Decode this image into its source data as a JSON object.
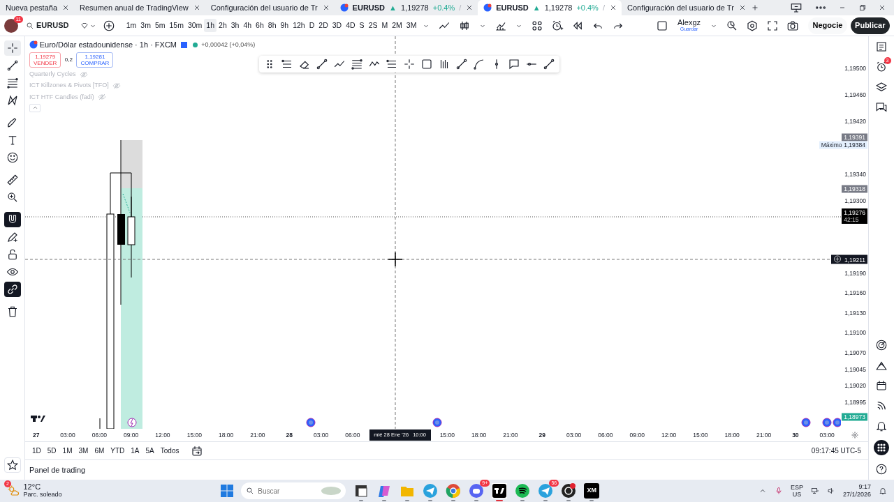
{
  "browser_tabs": [
    {
      "kind": "page",
      "title": "Nueva pestaña",
      "selected": false
    },
    {
      "kind": "page",
      "title": "Resumen anual de TradingView",
      "selected": false
    },
    {
      "kind": "page",
      "title": "Configuración del usuario de Tr",
      "selected": false
    },
    {
      "kind": "symbol",
      "title": "EURUSD",
      "arrow": "▲",
      "price": "1,19278",
      "change": "+0.4%",
      "trail": "/",
      "selected": false
    },
    {
      "kind": "symbol",
      "title": "EURUSD",
      "arrow": "▲",
      "price": "1,19278",
      "change": "+0.4%",
      "trail": "/",
      "selected": true
    },
    {
      "kind": "page",
      "title": "Configuración del usuario de Tr",
      "selected": false
    }
  ],
  "toolbar": {
    "avatar_badge": "11",
    "symbol": "EURUSD",
    "intervals": [
      {
        "label": "1m",
        "selected": false
      },
      {
        "label": "3m",
        "selected": false
      },
      {
        "label": "5m",
        "selected": false
      },
      {
        "label": "15m",
        "selected": false
      },
      {
        "label": "30m",
        "selected": false
      },
      {
        "label": "1h",
        "selected": true
      },
      {
        "label": "2h",
        "selected": false
      },
      {
        "label": "3h",
        "selected": false
      },
      {
        "label": "4h",
        "selected": false
      },
      {
        "label": "6h",
        "selected": false
      },
      {
        "label": "8h",
        "selected": false
      },
      {
        "label": "9h",
        "selected": false
      },
      {
        "label": "12h",
        "selected": false
      },
      {
        "label": "D",
        "selected": false
      },
      {
        "label": "2D",
        "selected": false
      },
      {
        "label": "3D",
        "selected": false
      },
      {
        "label": "4D",
        "selected": false
      },
      {
        "label": "S",
        "selected": false
      },
      {
        "label": "2S",
        "selected": false
      },
      {
        "label": "M",
        "selected": false
      },
      {
        "label": "2M",
        "selected": false
      },
      {
        "label": "3M",
        "selected": false
      }
    ],
    "user": {
      "name": "Alexgz",
      "action": "Guardar"
    },
    "trade_button": "Negocie",
    "publish_button": "Publicar"
  },
  "left_tools": [
    {
      "kind": "crosshair",
      "selected": true,
      "on": false
    },
    {
      "kind": "trendline",
      "selected": false,
      "on": false
    },
    {
      "kind": "fib",
      "selected": false,
      "on": false
    },
    {
      "kind": "pattern",
      "selected": false,
      "on": false
    },
    {
      "kind": "brush",
      "selected": false,
      "on": false
    },
    {
      "kind": "text",
      "selected": false,
      "on": false
    },
    {
      "kind": "smiley",
      "selected": false,
      "on": false
    },
    {
      "kind": "ruler",
      "selected": false,
      "on": false
    },
    {
      "kind": "zoom",
      "selected": false,
      "on": false
    },
    {
      "kind": "magnet",
      "selected": false,
      "on": true
    },
    {
      "kind": "pencil",
      "selected": false,
      "on": false
    },
    {
      "kind": "lock",
      "selected": false,
      "on": false
    },
    {
      "kind": "eye",
      "selected": false,
      "on": false
    },
    {
      "kind": "link",
      "selected": false,
      "on": true
    },
    {
      "kind": "trash",
      "selected": false,
      "on": false
    }
  ],
  "legend": {
    "title": "Euro/Dólar estadounidense · 1h · FXCM",
    "change": "+0,00042 (+0,04%)",
    "sell": {
      "price": "1,19279",
      "label": "VENDER"
    },
    "spread": "0,2",
    "buy": {
      "price": "1,19281",
      "label": "COMPRAR"
    },
    "indicators": [
      {
        "name": "Quarterly Cycles",
        "hidden": true
      },
      {
        "name": "ICT Killzones & Pivots [TFO]",
        "hidden": true
      },
      {
        "name": "ICT HTF Candles (fadi)",
        "hidden": true
      }
    ]
  },
  "price_axis": {
    "ticks": [
      "1,19500",
      "1,19460",
      "1,19420",
      "1,19340",
      "1,19300",
      "1,19190",
      "1,19160",
      "1,19130",
      "1,19100",
      "1,19070",
      "1,19045",
      "1,19020",
      "1,18995"
    ],
    "tags": [
      {
        "kind": "gray",
        "value": "1,19391"
      },
      {
        "kind": "light",
        "value": "1,19384",
        "label": "Máximo"
      },
      {
        "kind": "gray",
        "value": "1,19318"
      },
      {
        "kind": "dark",
        "value": "1,19276",
        "sub": "42:15"
      },
      {
        "kind": "cursor",
        "value": "1,19211"
      },
      {
        "kind": "green",
        "value": "1,18973"
      }
    ]
  },
  "time_axis": [
    {
      "kind": "day",
      "text": "27"
    },
    {
      "kind": "time",
      "text": "03:00"
    },
    {
      "kind": "time",
      "text": "06:00"
    },
    {
      "kind": "time",
      "text": "09:00"
    },
    {
      "kind": "time",
      "text": "12:00"
    },
    {
      "kind": "time",
      "text": "15:00"
    },
    {
      "kind": "time",
      "text": "18:00"
    },
    {
      "kind": "time",
      "text": "21:00"
    },
    {
      "kind": "day",
      "text": "28"
    },
    {
      "kind": "time",
      "text": "03:00"
    },
    {
      "kind": "time",
      "text": "06:00"
    },
    {
      "kind": "cursor",
      "text": "mié 28 Ene '26",
      "time": "10:00"
    },
    {
      "kind": "time",
      "text": "15:00"
    },
    {
      "kind": "time",
      "text": "18:00"
    },
    {
      "kind": "time",
      "text": "21:00"
    },
    {
      "kind": "day",
      "text": "29"
    },
    {
      "kind": "time",
      "text": "03:00"
    },
    {
      "kind": "time",
      "text": "06:00"
    },
    {
      "kind": "time",
      "text": "09:00"
    },
    {
      "kind": "time",
      "text": "12:00"
    },
    {
      "kind": "time",
      "text": "15:00"
    },
    {
      "kind": "time",
      "text": "18:00"
    },
    {
      "kind": "time",
      "text": "21:00"
    },
    {
      "kind": "day",
      "text": "30"
    },
    {
      "kind": "time",
      "text": "03:00"
    }
  ],
  "ranges": [
    "1D",
    "5D",
    "1M",
    "3M",
    "6M",
    "YTD",
    "1A",
    "5A",
    "Todos"
  ],
  "clock": "09:17:45 UTC-5",
  "trading_panel": {
    "title": "Panel de trading"
  },
  "sidebar": {
    "alarm_badge": "3"
  },
  "taskbar": {
    "weather": {
      "badge": "2",
      "temp": "12°C",
      "desc": "Parc. soleado"
    },
    "search": {
      "placeholder": "Buscar"
    },
    "apps": [
      {
        "kind": "taskview",
        "active": false
      },
      {
        "kind": "copilot",
        "active": false
      },
      {
        "kind": "folder",
        "active": false
      },
      {
        "kind": "telegram",
        "active": false
      },
      {
        "kind": "chrome",
        "active": false
      },
      {
        "kind": "discord",
        "badge": "9+",
        "active": false
      },
      {
        "kind": "tradingview",
        "active": true
      },
      {
        "kind": "spotify",
        "active": false
      },
      {
        "kind": "telegram",
        "badge": "56",
        "active": false
      },
      {
        "kind": "obs",
        "active": false
      },
      {
        "kind": "xm",
        "label": "XM",
        "active": false
      }
    ],
    "lang": "ESP",
    "region": "US",
    "time": "9:17",
    "date": "27/1/2026"
  }
}
